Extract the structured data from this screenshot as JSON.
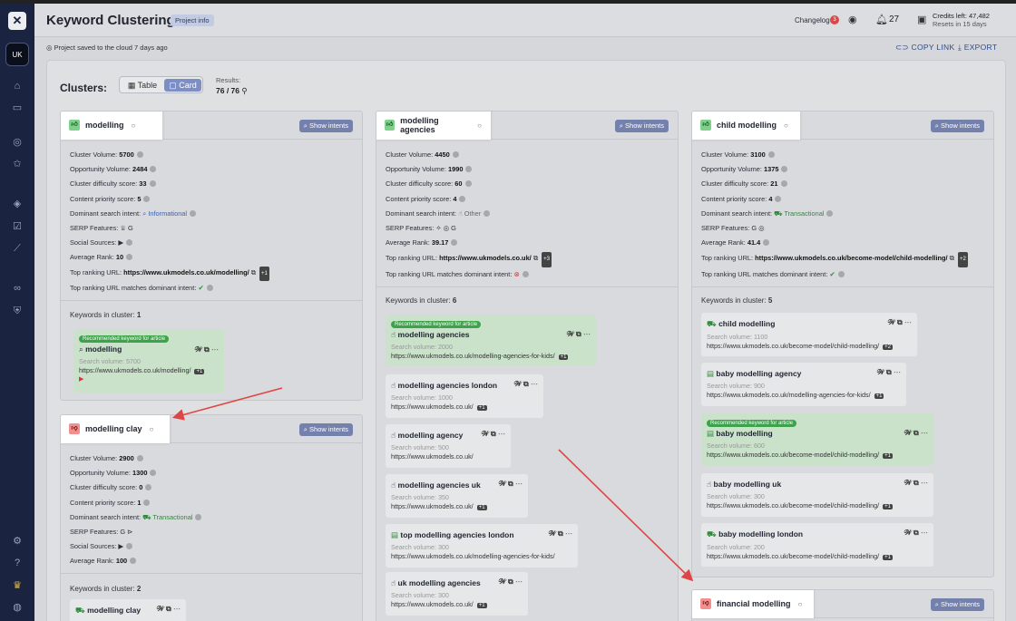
{
  "app": {
    "title": "Keyword Clustering",
    "project_info": "Project info",
    "changelog": "Changelog",
    "changelog_count": "3",
    "notifications": "27",
    "credits": "Credits left: 47,482",
    "credits_reset": "Resets in 15 days",
    "saved": "Project saved to the cloud 7 days ago",
    "copy_link": "COPY LINK",
    "export": "EXPORT",
    "avatar": "UK"
  },
  "view": {
    "heading": "Clusters:",
    "table": "Table",
    "card": "Card",
    "results_label": "Results:",
    "results": "76 / 76"
  },
  "labels": {
    "show_intents": "Show intents",
    "vol": "Cluster Volume:",
    "opp": "Opportunity Volume:",
    "diff": "Cluster difficulty score:",
    "prio": "Content priority score:",
    "intent": "Dominant search intent:",
    "serp": "SERP Features:",
    "social": "Social Sources:",
    "rank": "Average Rank:",
    "top_url": "Top ranking URL:",
    "matches": "Top ranking URL matches dominant intent:",
    "kw_in": "Keywords in cluster:",
    "search_vol": "Search volume:",
    "recommended": "Recommended keyword for article"
  },
  "clusters": [
    {
      "name": "modelling",
      "vol": "5700",
      "opp": "2484",
      "diff": "33",
      "prio": "5",
      "intent": "Informational",
      "rank": "10",
      "url": "https://www.ukmodels.co.uk/modelling/",
      "url_more": "+1",
      "kw_count": "1",
      "keywords": [
        {
          "name": "modelling",
          "vol": "5700",
          "url": "https://www.ukmodels.co.uk/modelling/",
          "more": "+1"
        }
      ]
    },
    {
      "name": "modelling agencies",
      "vol": "4450",
      "opp": "1990",
      "diff": "60",
      "prio": "4",
      "intent": "Other",
      "rank": "39.17",
      "url": "https://www.ukmodels.co.uk/",
      "url_more": "+3",
      "kw_count": "6",
      "keywords": [
        {
          "name": "modelling agencies",
          "vol": "2000",
          "url": "https://www.ukmodels.co.uk/modelling-agencies-for-kids/",
          "more": "+1"
        },
        {
          "name": "modelling agencies london",
          "vol": "1000",
          "url": "https://www.ukmodels.co.uk/",
          "more": "+1"
        },
        {
          "name": "modelling agency",
          "vol": "500",
          "url": "https://www.ukmodels.co.uk/",
          "more": ""
        },
        {
          "name": "modelling agencies uk",
          "vol": "350",
          "url": "https://www.ukmodels.co.uk/",
          "more": "+1"
        },
        {
          "name": "top modelling agencies london",
          "vol": "300",
          "url": "https://www.ukmodels.co.uk/modelling-agencies-for-kids/",
          "more": ""
        },
        {
          "name": "uk modelling agencies",
          "vol": "300",
          "url": "https://www.ukmodels.co.uk/",
          "more": "+1"
        }
      ]
    },
    {
      "name": "child modelling",
      "vol": "3100",
      "opp": "1375",
      "diff": "21",
      "prio": "4",
      "intent": "Transactional",
      "rank": "41.4",
      "url": "https://www.ukmodels.co.uk/become-model/child-modelling/",
      "url_more": "+2",
      "kw_count": "5",
      "keywords": [
        {
          "name": "child modelling",
          "vol": "1100",
          "url": "https://www.ukmodels.co.uk/become-model/child-modelling/",
          "more": "+2"
        },
        {
          "name": "baby modelling agency",
          "vol": "900",
          "url": "https://www.ukmodels.co.uk/modelling-agencies-for-kids/",
          "more": "+1"
        },
        {
          "name": "baby modelling",
          "vol": "600",
          "url": "https://www.ukmodels.co.uk/become-model/child-modelling/",
          "more": "+1"
        },
        {
          "name": "baby modelling uk",
          "vol": "300",
          "url": "https://www.ukmodels.co.uk/become-model/child-modelling/",
          "more": "+1"
        },
        {
          "name": "baby modelling london",
          "vol": "200",
          "url": "https://www.ukmodels.co.uk/become-model/child-modelling/",
          "more": "+1"
        }
      ]
    },
    {
      "name": "modelling clay",
      "vol": "2900",
      "opp": "1300",
      "diff": "0",
      "prio": "1",
      "intent": "Transactional",
      "rank": "100",
      "kw_count": "2",
      "keywords": [
        {
          "name": "modelling clay"
        }
      ]
    },
    {
      "name": "financial modelling"
    }
  ],
  "colors": {
    "sidebar": "#1a2340",
    "accent": "#7581ad",
    "recommended": "#c9e2c9",
    "arrow": "#e04545"
  }
}
